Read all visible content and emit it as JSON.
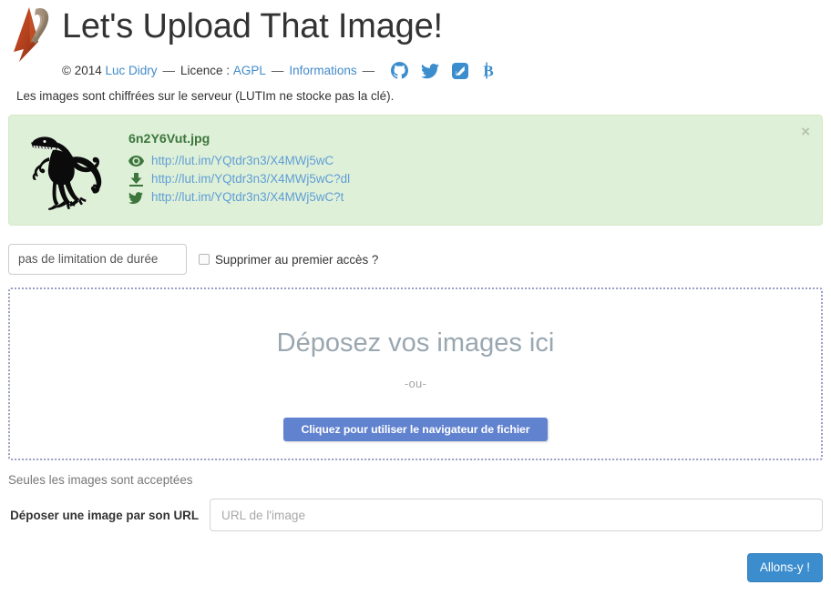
{
  "header": {
    "title": "Let's Upload That Image!",
    "logo_icon": "lutim-hat-logo",
    "copyright": "© 2014",
    "author_link": "Luc Didry",
    "separator": "—",
    "licence_label": "Licence :",
    "licence_link": "AGPL",
    "info_link": "Informations",
    "social": [
      {
        "name": "github-icon",
        "label": "GitHub"
      },
      {
        "name": "twitter-icon",
        "label": "Twitter"
      },
      {
        "name": "flattr-icon",
        "label": "Flattr"
      },
      {
        "name": "bitcoin-icon",
        "label": "Bitcoin"
      }
    ]
  },
  "notice": "Les images sont chiffrées sur le serveur (LUTIm ne stocke pas la clé).",
  "uploaded": {
    "thumbnail_icon": "raptor-dinosaur-thumbnail",
    "filename": "6n2Y6Vut.jpg",
    "close_label": "×",
    "links": [
      {
        "icon": "eye-icon",
        "url": "http://lut.im/YQtdr3n3/X4MWj5wC"
      },
      {
        "icon": "download-icon",
        "url": "http://lut.im/YQtdr3n3/X4MWj5wC?dl"
      },
      {
        "icon": "twitter-bird-icon",
        "url": "http://lut.im/YQtdr3n3/X4MWj5wC?t"
      }
    ]
  },
  "options": {
    "delay_selected": "pas de limitation de durée",
    "delay_options": [
      "pas de limitation de durée"
    ],
    "first_view_checkbox_label": "Supprimer au premier accès ?",
    "first_view_checked": false
  },
  "dropzone": {
    "title": "Déposez vos images ici",
    "or": "-ou-",
    "browse_button": "Cliquez pour utiliser le navigateur de fichier"
  },
  "accepted_note": "Seules les images sont acceptées",
  "url_form": {
    "label": "Déposer une image par son URL",
    "placeholder": "URL de l'image",
    "value": ""
  },
  "submit": {
    "label": "Allons-y !"
  },
  "colors": {
    "link": "#428bca",
    "social_icon": "#3c8dcd",
    "success_bg": "#dff0d8",
    "success_border": "#d6e9c6",
    "success_text": "#3c763d",
    "dropzone_border": "#9a9ec4",
    "dropzone_title": "#9aa7b0",
    "primary_button": "#6182cf",
    "submit_button": "#3c8dcd"
  }
}
